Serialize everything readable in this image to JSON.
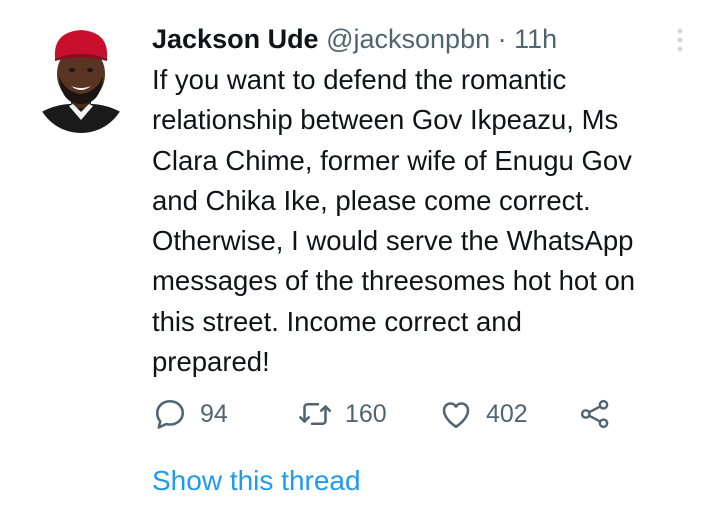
{
  "tweet": {
    "author_name": "Jackson Ude",
    "handle": "@jacksonpbn",
    "separator": "·",
    "time": "11h",
    "text_lines": [
      "If you want to defend the romantic",
      "relationship between Gov Ikpeazu, Ms",
      "Clara Chime, former wife of Enugu Gov",
      "and Chika Ike, please come correct.",
      "Otherwise, I would serve the WhatsApp",
      "messages of the threesomes hot hot on",
      "this street. Income correct and",
      "prepared!"
    ],
    "replies": "94",
    "retweets": "160",
    "likes": "402",
    "show_thread_label": "Show this thread"
  },
  "colors": {
    "text": "#0f1419",
    "muted": "#536471",
    "link": "#1d9bf0",
    "cap_red": "#c8102e"
  },
  "icons": [
    "avatar",
    "more-icon",
    "reply-icon",
    "retweet-icon",
    "like-icon",
    "share-icon"
  ]
}
